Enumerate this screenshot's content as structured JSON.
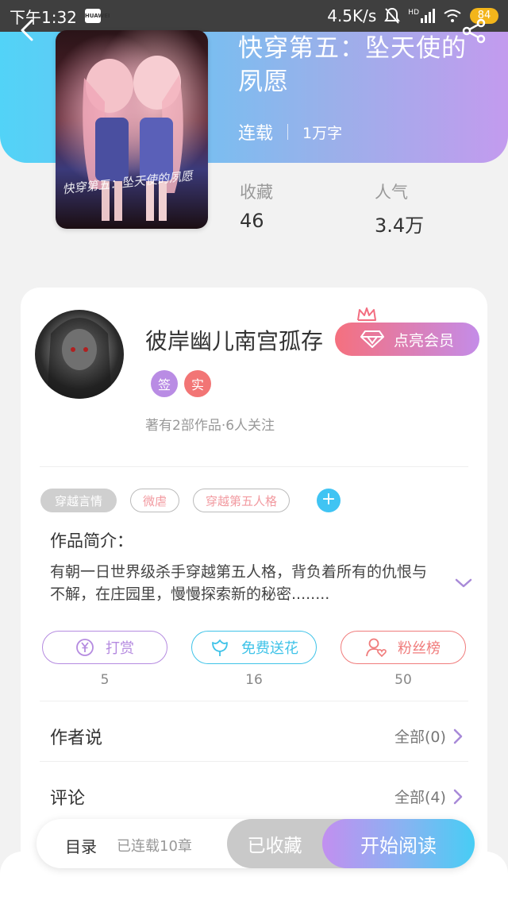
{
  "status_bar": {
    "time": "下午1:32",
    "app_badge": "HUAWEI",
    "net_speed": "4.5K/s",
    "network": "HD",
    "battery": "84"
  },
  "book": {
    "title": "快穿第五：坠天使的夙愿",
    "cover_text": "快穿第五：坠天使的夙愿",
    "status": "连载",
    "word_count": "1万字",
    "stats": {
      "favorites_label": "收藏",
      "favorites_value": "46",
      "popularity_label": "人气",
      "popularity_value": "3.4万"
    }
  },
  "author": {
    "name": "彼岸幽儿南宫孤存",
    "vip_button": "点亮会员",
    "badges": [
      "签",
      "实"
    ],
    "stats": "著有2部作品·6人关注"
  },
  "tags": {
    "items": [
      "穿越言情",
      "微虐",
      "穿越第五人格"
    ],
    "add": "+"
  },
  "intro": {
    "title": "作品简介：",
    "text": "有朝一日世界级杀手穿越第五人格，背负着所有的仇恨与不解，在庄园里，慢慢探索新的秘密........"
  },
  "actions": [
    {
      "label": "打赏",
      "count": "5",
      "color": "#b58be0",
      "icon": "yen-icon"
    },
    {
      "label": "免费送花",
      "count": "16",
      "color": "#3fc3e8",
      "icon": "flower-icon"
    },
    {
      "label": "粉丝榜",
      "count": "50",
      "color": "#f07c7c",
      "icon": "fan-icon"
    }
  ],
  "rows": {
    "author_says": {
      "title": "作者说",
      "value": "全部(0)"
    },
    "comments": {
      "title": "评论",
      "value": "全部(4)"
    }
  },
  "bottom": {
    "toc": "目录",
    "chapters": "已连载10章",
    "collected": "已收藏",
    "read": "开始阅读"
  },
  "colors": {
    "header_start": "#52d3f7",
    "header_end": "#c39bee",
    "accent_blue": "#40c4f3",
    "accent_purple": "#b58be0",
    "accent_pink": "#f5707e"
  }
}
